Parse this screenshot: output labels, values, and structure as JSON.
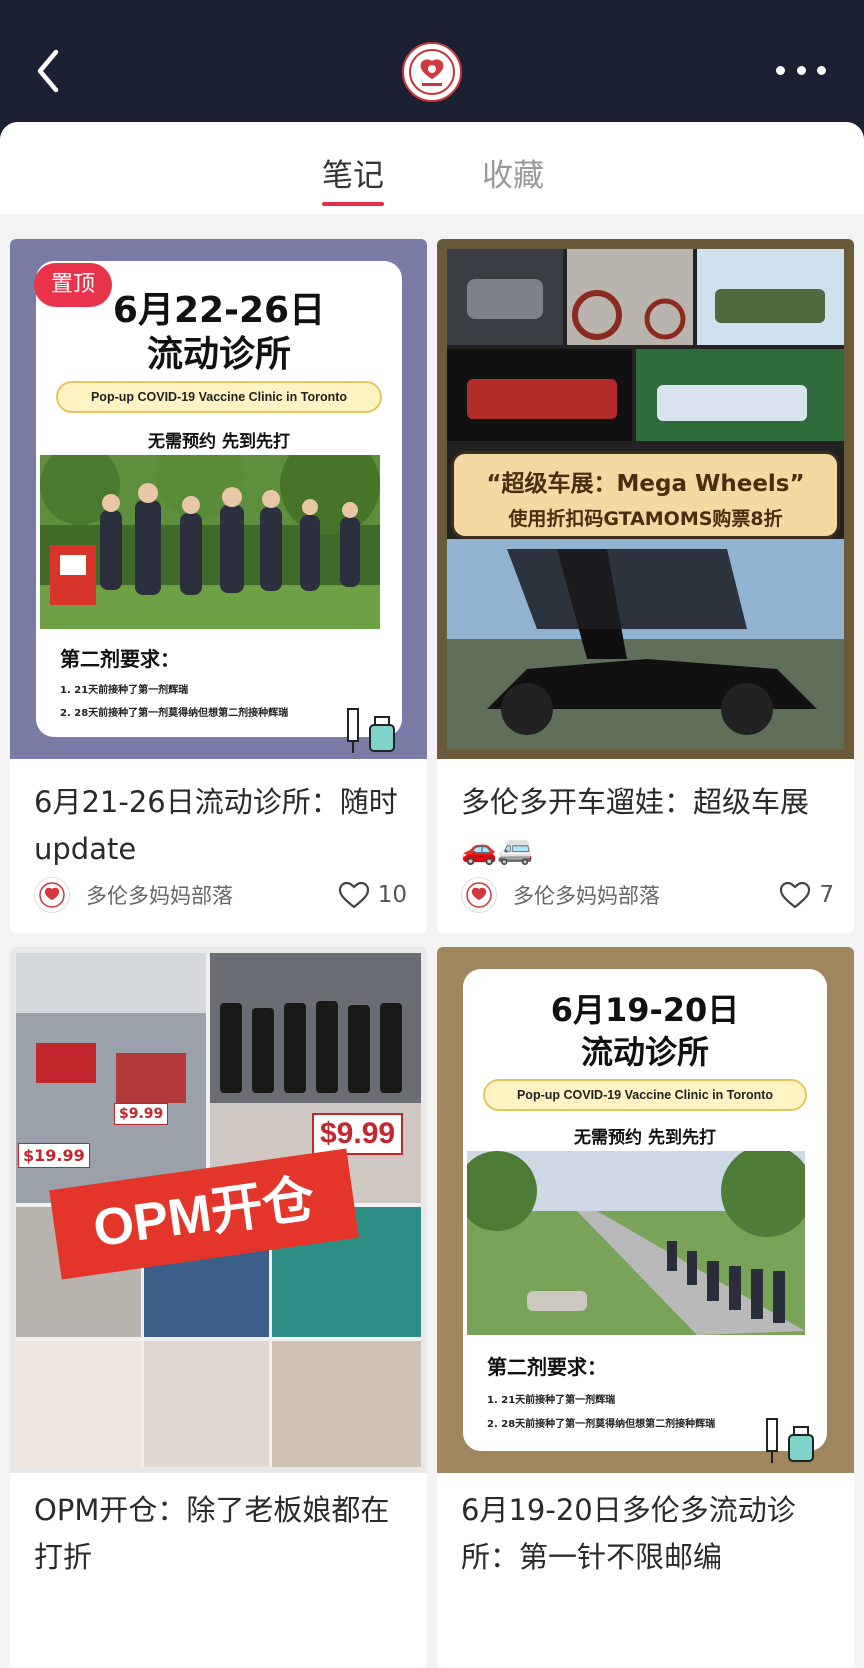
{
  "header": {
    "back_icon": "chevron-left-icon",
    "logo_icon": "community-logo-icon",
    "more_icon": "more-dots-icon"
  },
  "tabs": [
    {
      "label": "笔记",
      "active": true
    },
    {
      "label": "收藏",
      "active": false
    }
  ],
  "accent_color": "#e0334a",
  "cards": [
    {
      "pinned_label": "置顶",
      "poster": {
        "title_line1": "6月22-26日",
        "title_line2": "流动诊所",
        "pill": "Pop-up COVID-19 Vaccine Clinic in Toronto",
        "highlight": "无需预约  先到先打",
        "req_title": "第二剂要求：",
        "req_items": [
          "1. 21天前接种了第一剂辉瑞",
          "2. 28天前接种了第一剂莫得纳但想第二剂接种辉瑞"
        ]
      },
      "title": "6月21-26日流动诊所：随时update",
      "author": "多伦多妈妈部落",
      "likes": "10"
    },
    {
      "poster": {
        "banner_line1": "“超级车展：Mega Wheels”",
        "banner_line2": "使用折扣码GTAMOMS购票8折"
      },
      "title": "多伦多开车遛娃：超级车展🚗🚐",
      "author": "多伦多妈妈部落",
      "likes": "7"
    },
    {
      "poster": {
        "tag": "OPM开仓",
        "price_1": "$9.99",
        "price_2": "$19.99",
        "price_3": "$9.99"
      },
      "title": "OPM开仓：除了老板娘都在打折"
    },
    {
      "poster": {
        "title_line1": "6月19-20日",
        "title_line2": "流动诊所",
        "pill": "Pop-up COVID-19 Vaccine Clinic in Toronto",
        "highlight": "无需预约  先到先打",
        "req_title": "第二剂要求：",
        "req_items": [
          "1. 21天前接种了第一剂辉瑞",
          "2. 28天前接种了第一剂莫得纳但想第二剂接种辉瑞"
        ]
      },
      "title": "6月19-20日多伦多流动诊所：第一针不限邮编"
    }
  ]
}
